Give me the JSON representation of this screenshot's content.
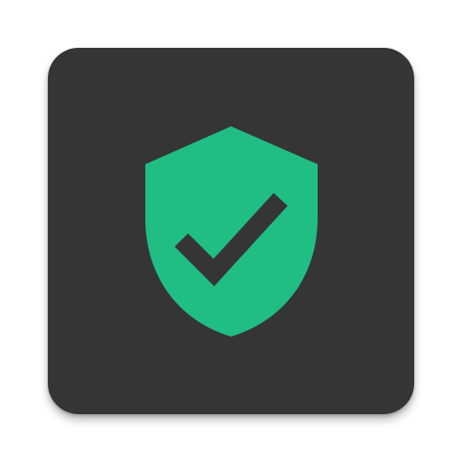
{
  "app_icon": {
    "icon": "shield-check-icon",
    "colors": {
      "tile_background": "#353535",
      "shield": "#20BE84",
      "checkmark": "#353535"
    }
  }
}
